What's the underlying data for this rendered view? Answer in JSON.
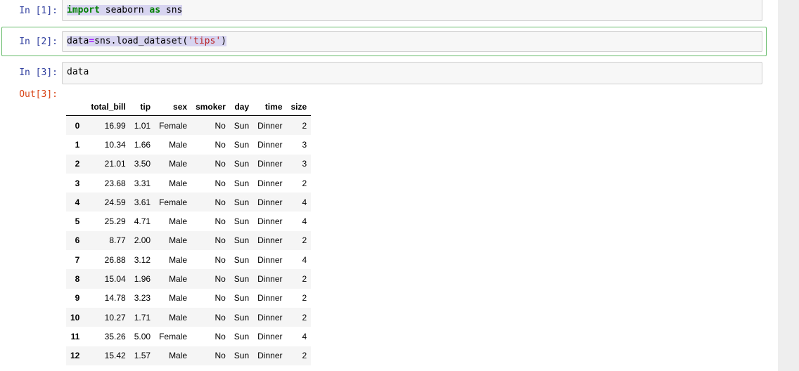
{
  "cells": [
    {
      "prompt": "In [1]:",
      "code": {
        "kw": "import",
        "mid": " seaborn ",
        "kw2": "as",
        "end": " sns"
      }
    },
    {
      "prompt": "In [2]:",
      "code": {
        "pre": "data",
        "op": "=",
        "mid": "sns.load_dataset(",
        "str": "'tips'",
        "end": ")"
      }
    },
    {
      "prompt": "In [3]:",
      "code": "data"
    }
  ],
  "output": {
    "prompt": "Out[3]:"
  },
  "table": {
    "columns": [
      "total_bill",
      "tip",
      "sex",
      "smoker",
      "day",
      "time",
      "size"
    ],
    "rows": [
      {
        "index": "0",
        "cells": [
          "16.99",
          "1.01",
          "Female",
          "No",
          "Sun",
          "Dinner",
          "2"
        ]
      },
      {
        "index": "1",
        "cells": [
          "10.34",
          "1.66",
          "Male",
          "No",
          "Sun",
          "Dinner",
          "3"
        ]
      },
      {
        "index": "2",
        "cells": [
          "21.01",
          "3.50",
          "Male",
          "No",
          "Sun",
          "Dinner",
          "3"
        ]
      },
      {
        "index": "3",
        "cells": [
          "23.68",
          "3.31",
          "Male",
          "No",
          "Sun",
          "Dinner",
          "2"
        ]
      },
      {
        "index": "4",
        "cells": [
          "24.59",
          "3.61",
          "Female",
          "No",
          "Sun",
          "Dinner",
          "4"
        ]
      },
      {
        "index": "5",
        "cells": [
          "25.29",
          "4.71",
          "Male",
          "No",
          "Sun",
          "Dinner",
          "4"
        ]
      },
      {
        "index": "6",
        "cells": [
          "8.77",
          "2.00",
          "Male",
          "No",
          "Sun",
          "Dinner",
          "2"
        ]
      },
      {
        "index": "7",
        "cells": [
          "26.88",
          "3.12",
          "Male",
          "No",
          "Sun",
          "Dinner",
          "4"
        ]
      },
      {
        "index": "8",
        "cells": [
          "15.04",
          "1.96",
          "Male",
          "No",
          "Sun",
          "Dinner",
          "2"
        ]
      },
      {
        "index": "9",
        "cells": [
          "14.78",
          "3.23",
          "Male",
          "No",
          "Sun",
          "Dinner",
          "2"
        ]
      },
      {
        "index": "10",
        "cells": [
          "10.27",
          "1.71",
          "Male",
          "No",
          "Sun",
          "Dinner",
          "2"
        ]
      },
      {
        "index": "11",
        "cells": [
          "35.26",
          "5.00",
          "Female",
          "No",
          "Sun",
          "Dinner",
          "4"
        ]
      },
      {
        "index": "12",
        "cells": [
          "15.42",
          "1.57",
          "Male",
          "No",
          "Sun",
          "Dinner",
          "2"
        ]
      }
    ]
  }
}
